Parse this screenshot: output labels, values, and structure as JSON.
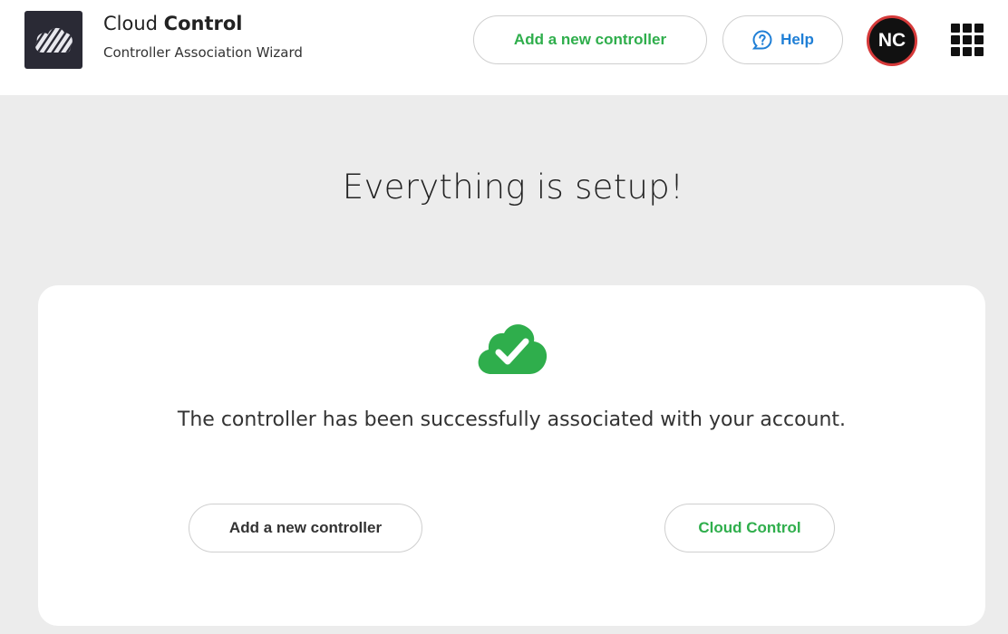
{
  "header": {
    "brand_light": "Cloud ",
    "brand_bold": "Control",
    "subtitle": "Controller Association Wizard",
    "add_button": "Add a new controller",
    "help_button": "Help",
    "avatar_initials": "NC",
    "logo_icon": "cloud-icon",
    "help_icon": "help-icon",
    "apps_icon": "grid-icon"
  },
  "main": {
    "title": "Everything is setup!",
    "message": "The controller has been successfully associated with your account.",
    "success_icon": "check-cloud-icon",
    "add_button": "Add a new controller",
    "cloud_button": "Cloud Control"
  },
  "colors": {
    "accent_green": "#2fae4c",
    "help_blue": "#1f7fd6",
    "avatar_border": "#d63a3a",
    "background": "#ececec"
  }
}
